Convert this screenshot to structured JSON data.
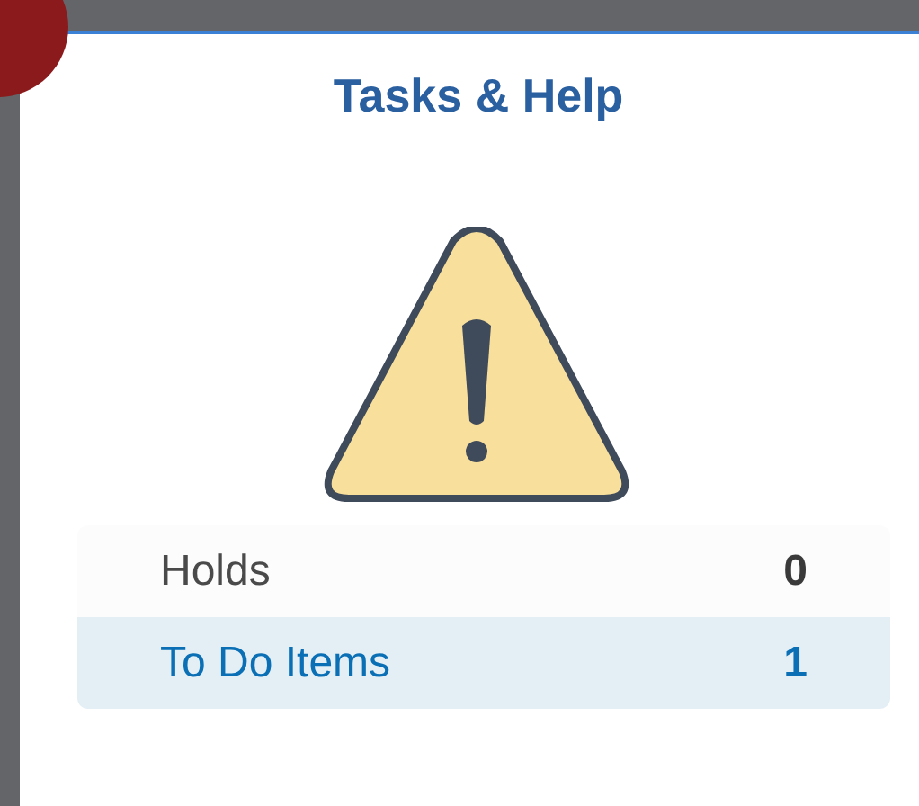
{
  "title": "Tasks & Help",
  "rows": [
    {
      "label": "Holds",
      "count": "0",
      "selected": false
    },
    {
      "label": "To Do Items",
      "count": "1",
      "selected": true
    }
  ]
}
